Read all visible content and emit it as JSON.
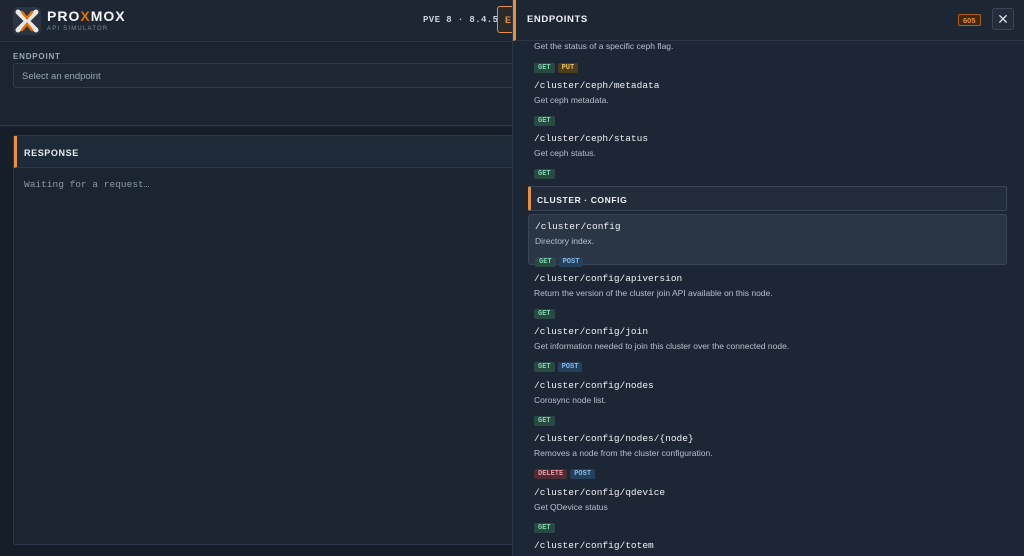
{
  "app": {
    "brand_pre": "PRO",
    "brand_x": "X",
    "brand_post": "MOX",
    "subtitle": "API SIMULATOR",
    "version": "PVE 8 · 8.4.5",
    "tab_partial": "E"
  },
  "endpoint": {
    "label": "ENDPOINT",
    "placeholder": "Select an endpoint"
  },
  "response": {
    "title": "RESPONSE",
    "waiting": "Waiting for a request…"
  },
  "drawer": {
    "title": "ENDPOINTS",
    "count": "605",
    "close_glyph": "✕",
    "top_partial": {
      "desc": "Get the status of a specific ceph flag.",
      "methods": [
        "GET",
        "PUT"
      ]
    },
    "items_ceph": [
      {
        "path": "/cluster/ceph/metadata",
        "desc": "Get ceph metadata.",
        "methods": [
          "GET"
        ]
      },
      {
        "path": "/cluster/ceph/status",
        "desc": "Get ceph status.",
        "methods": [
          "GET"
        ]
      }
    ],
    "section_title": "CLUSTER · CONFIG",
    "items_config": [
      {
        "path": "/cluster/config",
        "desc": "Directory index.",
        "methods": [
          "GET",
          "POST"
        ]
      },
      {
        "path": "/cluster/config/apiversion",
        "desc": "Return the version of the cluster join API available on this node.",
        "methods": [
          "GET"
        ]
      },
      {
        "path": "/cluster/config/join",
        "desc": "Get information needed to join this cluster over the connected node.",
        "methods": [
          "GET",
          "POST"
        ]
      },
      {
        "path": "/cluster/config/nodes",
        "desc": "Corosync node list.",
        "methods": [
          "GET"
        ]
      },
      {
        "path": "/cluster/config/nodes/{node}",
        "desc": "Removes a node from the cluster configuration.",
        "methods": [
          "DELETE",
          "POST"
        ]
      },
      {
        "path": "/cluster/config/qdevice",
        "desc": "Get QDevice status",
        "methods": [
          "GET"
        ]
      },
      {
        "path": "/cluster/config/totem",
        "desc": "",
        "methods": []
      }
    ]
  },
  "colors": {
    "accent": "#e8913a",
    "background": "#1b2431"
  }
}
